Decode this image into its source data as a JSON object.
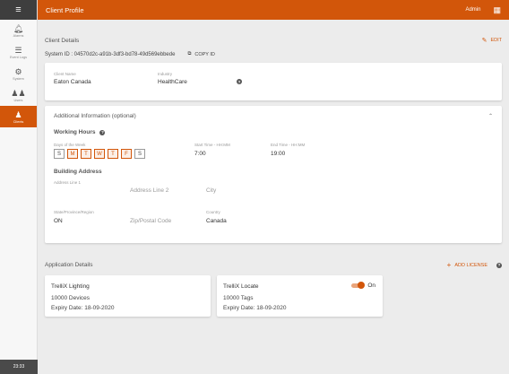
{
  "sidebar": {
    "menu_icon": "hamburger-icon",
    "items": [
      {
        "label": "Alarms",
        "icon": "bell-icon",
        "active": false
      },
      {
        "label": "Event Logs",
        "icon": "list-icon",
        "active": false
      },
      {
        "label": "System",
        "icon": "gear-icon",
        "active": false
      },
      {
        "label": "Users",
        "icon": "users-icon",
        "active": false
      },
      {
        "label": "Clients",
        "icon": "client-icon",
        "active": true
      }
    ],
    "clock": "23:33"
  },
  "topbar": {
    "title": "Client Profile",
    "user": "Admin",
    "apps_icon": "grid-icon"
  },
  "client_details": {
    "heading": "Client Details",
    "edit_label": "EDIT",
    "system_id": "System ID : 04570d2c-a91b-3df3-bd78-49d569ebbede",
    "copy_label": "COPY ID",
    "client_name_label": "Client Name",
    "client_name": "Eaton Canada",
    "industry_label": "Industry",
    "industry": "HealthCare"
  },
  "additional": {
    "heading": "Additional Information",
    "optional": "(optional)",
    "working_hours_title": "Working Hours",
    "days_label": "Days of the Week",
    "days": [
      {
        "label": "S",
        "selected": false
      },
      {
        "label": "M",
        "selected": true
      },
      {
        "label": "T",
        "selected": true
      },
      {
        "label": "W",
        "selected": true
      },
      {
        "label": "T",
        "selected": true
      },
      {
        "label": "F",
        "selected": true
      },
      {
        "label": "S",
        "selected": false
      }
    ],
    "start_label": "Start Time - HH:MM",
    "start_value": "7:00",
    "end_label": "End Time - HH:MM",
    "end_value": "19:00",
    "address_title": "Building Address",
    "addr1_label": "Address Line 1",
    "addr2_placeholder": "Address Line 2",
    "city_placeholder": "City",
    "state_label": "State/Province/Region",
    "state_value": "ON",
    "zip_placeholder": "Zip/Postal Code",
    "country_label": "Country",
    "country_value": "Canada"
  },
  "applications": {
    "heading": "Application Details",
    "add_label": "ADD LICENSE",
    "licenses": [
      {
        "name": "TrelliX Lighting",
        "count": "10000 Devices",
        "expiry": "Expiry Date: 18-09-2020"
      },
      {
        "name": "TrelliX Locate",
        "count": "10000 Tags",
        "expiry": "Expiry Date: 18-09-2020",
        "toggle_label": "On",
        "toggle_on": true
      }
    ]
  },
  "colors": {
    "accent": "#d2560a",
    "sidebar_dark": "#3e3e3e"
  }
}
